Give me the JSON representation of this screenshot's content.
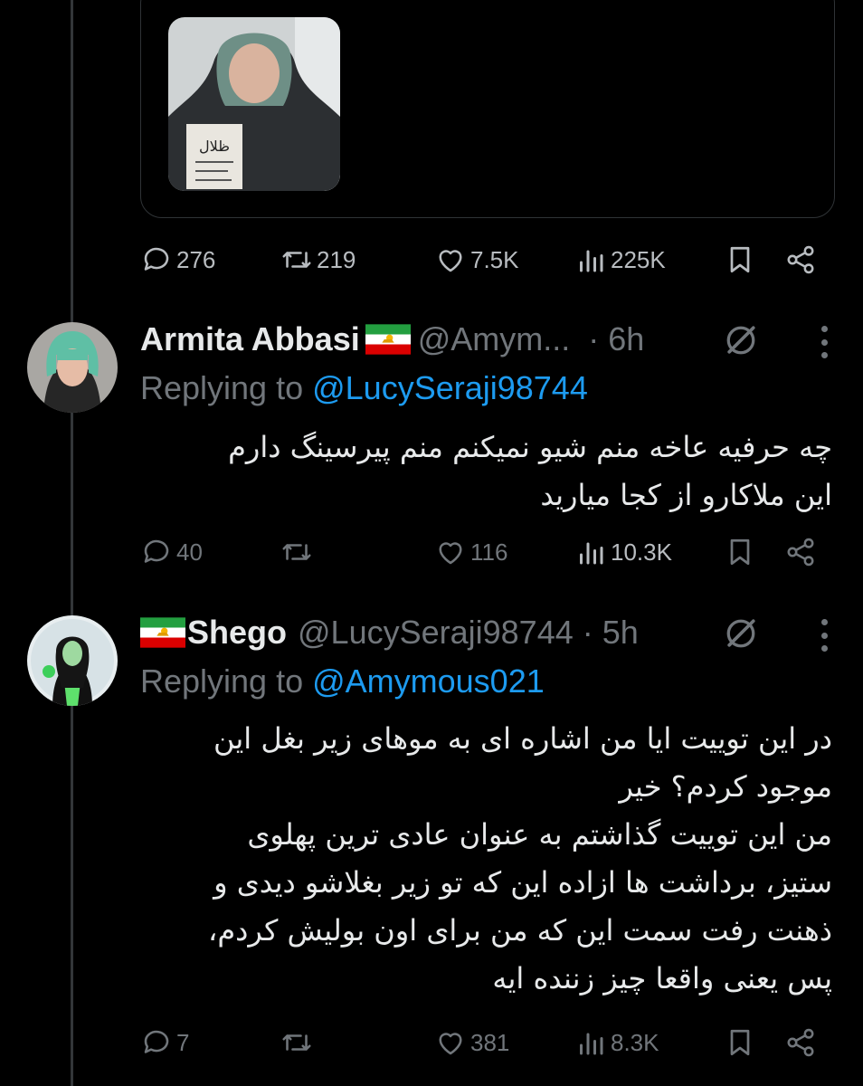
{
  "quoted_tweet": {
    "actions": {
      "replies": "276",
      "retweets": "219",
      "likes": "7.5K",
      "views": "225K"
    }
  },
  "replies": [
    {
      "name": "Armita Abbasi",
      "handle": "@Amym...",
      "time": "· 6h",
      "replying_label": "Replying to ",
      "replying_to": "@LucySeraji98744",
      "lines": [
        "چه حرفیه عاخه منم شیو نمیکنم منم پیرسینگ دارم",
        "این ملاکارو از کجا میارید"
      ],
      "actions": {
        "replies": "40",
        "retweets": "",
        "likes": "116",
        "views": "10.3K"
      }
    },
    {
      "name": "Shego",
      "handle": "@LucySeraji98744",
      "time": "· 5h",
      "replying_label": "Replying to ",
      "replying_to": "@Amymous021",
      "lines": [
        "در این توییت ایا من اشاره ای به موهای زیر بغل این",
        "موجود کردم؟ خیر",
        "من این توییت گذاشتم به عنوان عادی ترین پهلوی",
        "ستیز، برداشت ها ازاده این که تو زیر بغلاشو دیدی و",
        "ذهنت رفت سمت این که من برای اون بولیش کردم،",
        "پس یعنی واقعا چیز زننده ایه"
      ],
      "actions": {
        "replies": "7",
        "retweets": "",
        "likes": "381",
        "views": "8.3K"
      }
    }
  ],
  "icons": {
    "reply": "reply-icon",
    "retweet": "retweet-icon",
    "like": "like-icon",
    "views": "views-icon",
    "bookmark": "bookmark-icon",
    "share": "share-icon",
    "grok": "grok-icon",
    "more": "more-icon",
    "flag": "iran-lion-sun-flag"
  },
  "colors": {
    "background": "#000000",
    "text": "#e7e9ea",
    "muted": "#71767b",
    "link": "#1d9bf0",
    "border": "#2f3336"
  }
}
